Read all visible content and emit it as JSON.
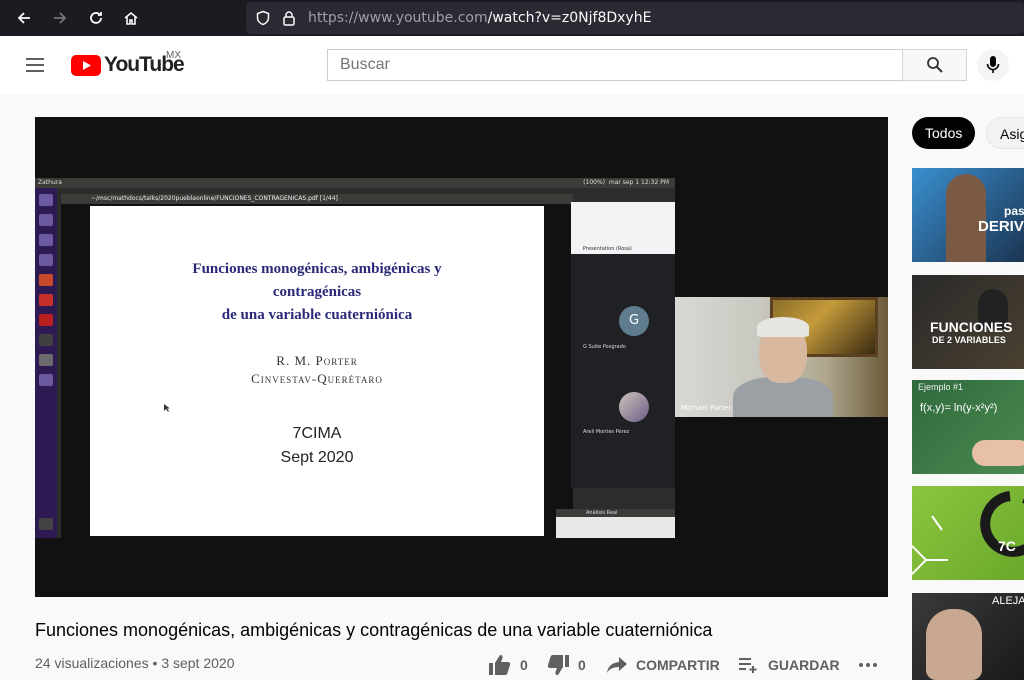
{
  "browser": {
    "url_host": "https://www.youtube.com",
    "url_path": "/watch?v=z0Njf8DxyhE"
  },
  "masthead": {
    "logo_text": "YouTube",
    "country_code": "MX",
    "search_placeholder": "Buscar"
  },
  "player": {
    "desktop_app_name": "Zathura",
    "desktop_clock": "mar sep 1  12:32 PM",
    "desktop_battery": "(100%)",
    "pdf_path": "~/msc/mathdocs/talks/2020pueblaonline/FUNCIONES_CONTRAGENICAS.pdf [1/44]",
    "slide": {
      "title_line1": "Funciones monogénicas, ambigénicas y",
      "title_line2": "contragénicas",
      "title_line3": "de una variable cuaterniónica",
      "author": "R. M. Porter",
      "institution": "Cinvestav-Querétaro",
      "event": "7CIMA",
      "date": "Sept 2020"
    },
    "participants": [
      {
        "initial": "G",
        "name": "G Suite Posgrado"
      },
      {
        "name": "Areli Montes Pérez"
      }
    ],
    "meet_top_label": "Presentation (Rosa)",
    "analisis_window": "Análisis Real",
    "webcam_name": "Michael Porter"
  },
  "video": {
    "title": "Funciones monogénicas, ambigénicas y contragénicas de una variable cuaterniónica",
    "views": "24 visualizaciones",
    "date": "3 sept 2020",
    "likes": "0",
    "dislikes": "0",
    "share_label": "COMPARTIR",
    "save_label": "GUARDAR"
  },
  "chips": [
    "Todos",
    "Asig"
  ],
  "recommendations": [
    {
      "overlay_line1": "pas",
      "overlay_line2": "DERIV",
      "colors": [
        "#3a8fd0",
        "#1b3552"
      ]
    },
    {
      "overlay_line1": "FUNCIONES",
      "overlay_line2": "DE 2 VARIABLES",
      "colors": [
        "#2a2a2a",
        "#4a4030"
      ]
    },
    {
      "overlay_line1": "Ejemplo #1",
      "overlay_line2": "f(x,y)= ln(y-x²y²)",
      "colors": [
        "#2f6a3c",
        "#4a8a52"
      ]
    },
    {
      "overlay_line1": "7C",
      "overlay_line2": "",
      "colors": [
        "#8cc63f",
        "#6aa82a"
      ]
    },
    {
      "overlay_line1": "ALEJA",
      "overlay_line2": "",
      "colors": [
        "#3a3a3a",
        "#1a1a1a"
      ]
    }
  ]
}
